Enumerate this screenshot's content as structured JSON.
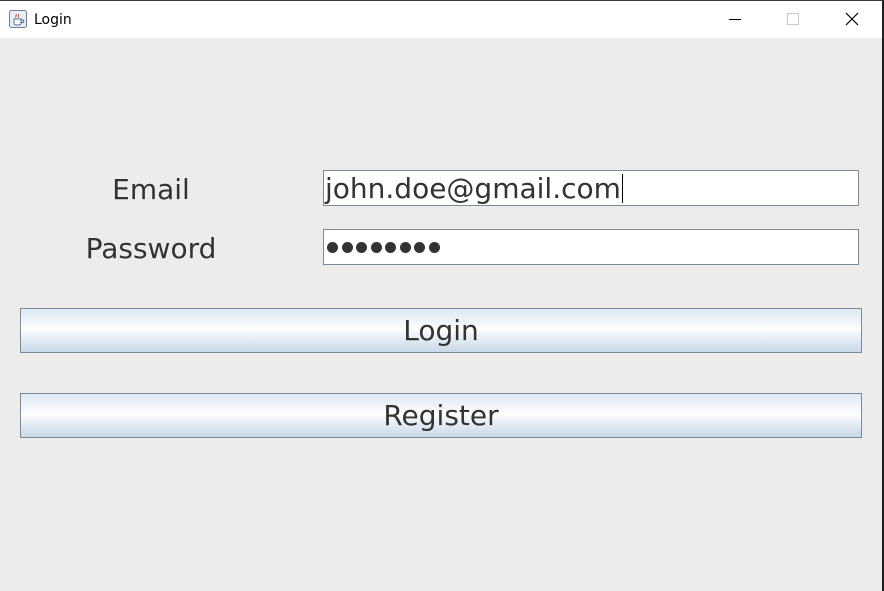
{
  "window": {
    "title": "Login",
    "icon": "java-cup-icon",
    "controls": {
      "minimize": "minimize-icon",
      "maximize": "maximize-icon",
      "close": "close-icon"
    }
  },
  "form": {
    "email_label": "Email",
    "email_value": "john.doe@gmail.com",
    "password_label": "Password",
    "password_masked_length": 8,
    "login_label": "Login",
    "register_label": "Register"
  },
  "colors": {
    "background": "#ececec",
    "field_border": "#7a8a99",
    "text": "#333333"
  }
}
